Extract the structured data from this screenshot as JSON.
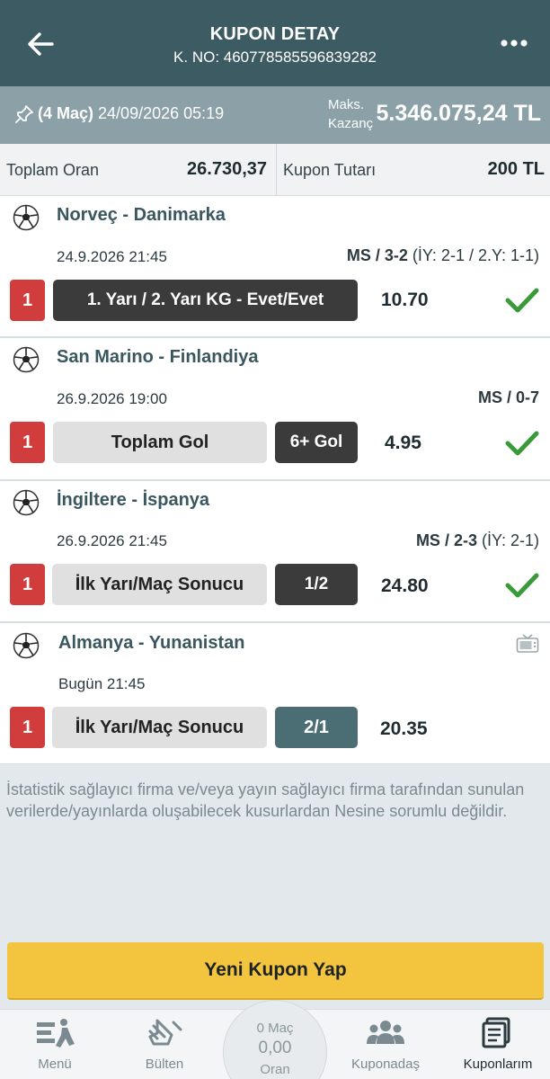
{
  "header": {
    "title": "KUPON DETAY",
    "coupon_no": "K. NO: 460778585596839282"
  },
  "summary": {
    "match_count": "(4 Maç)",
    "datetime": "24/09/2026 05:19",
    "max_win_label_1": "Maks.",
    "max_win_label_2": "Kazanç",
    "max_win_value": "5.346.075,24 TL"
  },
  "totals": {
    "total_odds_label": "Toplam Oran",
    "total_odds_value": "26.730,37",
    "stake_label": "Kupon Tutarı",
    "stake_value": "200 TL"
  },
  "matches": [
    {
      "teams": "Norveç - Danimarka",
      "date": "24.9.2026 21:45",
      "result_main": "MS / 3-2",
      "result_extra": " (İY: 2-1 / 2.Y: 1-1)",
      "mbs": "1",
      "market": "1. Yarı / 2. Yarı KG - Evet/Evet",
      "pick": "",
      "odds": "10.70",
      "won": true
    },
    {
      "teams": "San Marino - Finlandiya",
      "date": "26.9.2026 19:00",
      "result_main": "MS / 0-7",
      "result_extra": "",
      "mbs": "1",
      "market": "Toplam Gol",
      "pick": "6+ Gol",
      "odds": "4.95",
      "won": true
    },
    {
      "teams": "İngiltere - İspanya",
      "date": "26.9.2026 21:45",
      "result_main": "MS / 2-3",
      "result_extra": " (İY: 2-1)",
      "mbs": "1",
      "market": "İlk Yarı/Maç Sonucu",
      "pick": "1/2",
      "odds": "24.80",
      "won": true
    },
    {
      "teams": "Almanya - Yunanistan",
      "date": "Bugün 21:45",
      "result_main": "",
      "result_extra": "",
      "mbs": "1",
      "market": "İlk Yarı/Maç Sonucu",
      "pick": "2/1",
      "odds": "20.35",
      "won": false
    }
  ],
  "disclaimer": "İstatistik sağlayıcı firma ve/veya yayın sağlayıcı firma tarafından sunulan verilerde/yayınlarda oluşabilecek kusurlardan Nesine sorumlu değildir.",
  "cta_label": "Yeni Kupon Yap",
  "bottom_nav": {
    "items": [
      {
        "label": "Menü",
        "icon": "menu-icon"
      },
      {
        "label": "Bülten",
        "icon": "bulletin-icon"
      },
      {
        "label": "Kuponadaş",
        "icon": "community-icon"
      },
      {
        "label": "Kuponlarım",
        "icon": "coupons-icon"
      }
    ],
    "center": {
      "line1": "0 Maç",
      "line2": "0,00",
      "line3": "Oran"
    }
  },
  "colors": {
    "header_bg": "#3d5b62",
    "summary_bg": "#8ba0a7",
    "badge_red": "#d13c3c",
    "win_green": "#3a9a3a",
    "cta_yellow": "#f3c43d"
  }
}
